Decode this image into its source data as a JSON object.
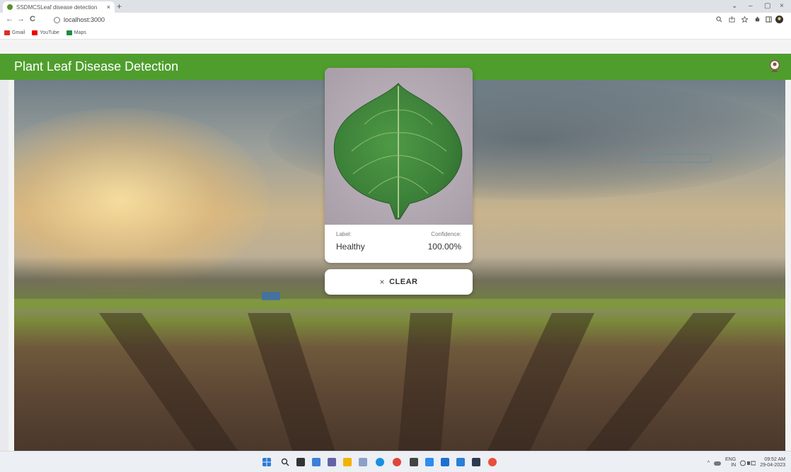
{
  "browser": {
    "tab_title": "SSDMCSLeaf disease detection",
    "tab_close": "×",
    "new_tab": "+",
    "window_controls": [
      "⌄",
      "–",
      "▢",
      "×"
    ],
    "nav": {
      "back": "←",
      "forward": "→",
      "reload": "C"
    },
    "url": "localhost:3000",
    "bookmarks": [
      {
        "label": "Gmail",
        "color": "#d93025"
      },
      {
        "label": "YouTube",
        "color": "#e00"
      },
      {
        "label": "Maps",
        "color": "#1e8e3e"
      }
    ]
  },
  "app": {
    "title": "Plant Leaf Disease Detection",
    "accent_color": "#4f9e2d"
  },
  "result": {
    "label_caption": "Label:",
    "label_value": "Healthy",
    "confidence_caption": "Confidence:",
    "confidence_value": "100.00%"
  },
  "clear_button": {
    "icon": "×",
    "label": "CLEAR"
  },
  "taskbar": {
    "tray_lang_top": "ENG",
    "tray_lang_bottom": "IN",
    "time": "09:52 AM",
    "date": "29-04-2023"
  }
}
